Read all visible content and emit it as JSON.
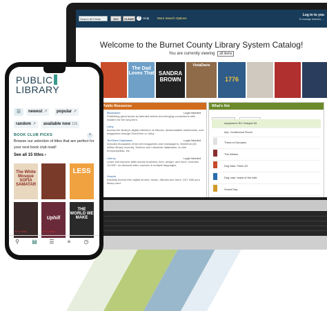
{
  "catalog": {
    "topbar": {
      "scope_select": "Search All Fields",
      "go_label": "GO!",
      "clear_label": "CLEAR",
      "help_label": "Help",
      "more_label": "More Search Options",
      "login_label": "Log in to you",
      "login_sub": "To manage reserves, ..."
    },
    "title": "Welcome to the Burnet County Library System Catalog!",
    "viewing_text": "You are currently viewing",
    "viewing_select": "all items",
    "covers": [
      {
        "text": "",
        "color": "#c94d2a"
      },
      {
        "text": "The Dad Loves That",
        "color": "#6ea0c8"
      },
      {
        "text": "SANDRA BROWN",
        "color": "#222222"
      },
      {
        "text": "ViolaDavis",
        "color": "#8f6b4a"
      },
      {
        "text": "1776",
        "color": "#2f5c8a"
      },
      {
        "text": "",
        "color": "#cfc9c0"
      },
      {
        "text": "",
        "color": "#b02f2f"
      },
      {
        "text": "",
        "color": "#2a3d5c"
      }
    ],
    "resources_header": "Public Resources",
    "resources": [
      {
        "logo": "Blackstone",
        "name": "Blackstone",
        "login": "Login Needed",
        "desc": "Publishing great books by talented writers and bringing connections with readers for the long term."
      },
      {
        "logo": "Libby",
        "name": "Libby",
        "login": "",
        "desc": "Access the library's digital collection of eBooks, downloadable audiobooks, and magazines through OverDrive or Libby."
      },
      {
        "logo": "TexShare",
        "name": "TexShare Databases",
        "login": "Login Needed",
        "desc": "Includes thousands of full-text magazines and newspapers, WorldCat (33 million library records), Science and Literature databases, on-line encyclopedias, etc."
      },
      {
        "logo": "Library",
        "name": "Udemy",
        "login": "Login Needed",
        "desc": "Learn and improve skills across business, tech, design, and more. Includes 10,000+ on-demand video courses in multiple languages."
      },
      {
        "logo": "",
        "name": "Hoopla",
        "login": "",
        "desc": "Instantly borrow free digital movies, music, eBooks and more, 24/7 with your library card."
      }
    ],
    "hot_header": "What's Hot",
    "hot_tabs": [
      "Most Popular",
      "What's New"
    ],
    "hot_items": [
      {
        "text": "equipment: BC Hotspot Kit",
        "thumb": "#ffffff"
      },
      {
        "text": "key: Conference Room",
        "thumb": "#ffffff"
      },
      {
        "text": "Thera of Gomawn",
        "thumb": "#eaeaea"
      },
      {
        "text": "The Widow",
        "thumb": "#8a2f2f"
      },
      {
        "text": "Dog Man: Fetch-22",
        "thumb": "#c44a2a"
      },
      {
        "text": "Dog man: brawl of the wild",
        "thumb": "#2a6bb0"
      },
      {
        "text": "Grand Day",
        "thumb": "#d09a2a"
      }
    ]
  },
  "phone": {
    "logo_line1": "PUBLIC",
    "logo_line2": "LIBRARY",
    "chips": [
      {
        "label": "newest",
        "x": "↗"
      },
      {
        "label": "popular",
        "x": "↗"
      },
      {
        "label": "random",
        "x": "↗"
      },
      {
        "label": "available now",
        "count": "12k"
      }
    ],
    "bcp_title": "BOOK CLUB PICKS",
    "bcp_desc": "Browse our selection of titles that are perfect for your next book club read!",
    "see_all": "See all 15 titles ›",
    "books": [
      {
        "text": "The White Mosque SOFIA SAMATAR",
        "color": "#e9d7c0",
        "fg": "#8c2d22"
      },
      {
        "text": "",
        "color": "#7a3a2a",
        "fg": "#ffffff"
      },
      {
        "text": "LESS",
        "color": "#f0a240",
        "fg": "#ffffff"
      },
      {
        "text": "",
        "color": "#3a2a2a",
        "fg": "#ffffff"
      },
      {
        "text": "Uphill",
        "color": "#6a2a3a",
        "fg": "#ffffff"
      },
      {
        "text": "THE WORLD WE MAKE",
        "color": "#2a2a2a",
        "fg": "#ffffff"
      }
    ],
    "book_tags": [
      "♥ 3 Holds",
      "♥ 4 Holds"
    ],
    "nav_icons": [
      "search-icon",
      "library-icon",
      "menu-icon",
      "stack-icon",
      "clock-icon"
    ]
  },
  "colors": {
    "topbar": "#173b58",
    "resources_header": "#d06c1e",
    "hot_header": "#6b8a2b",
    "accent_teal": "#3a9a8d"
  }
}
